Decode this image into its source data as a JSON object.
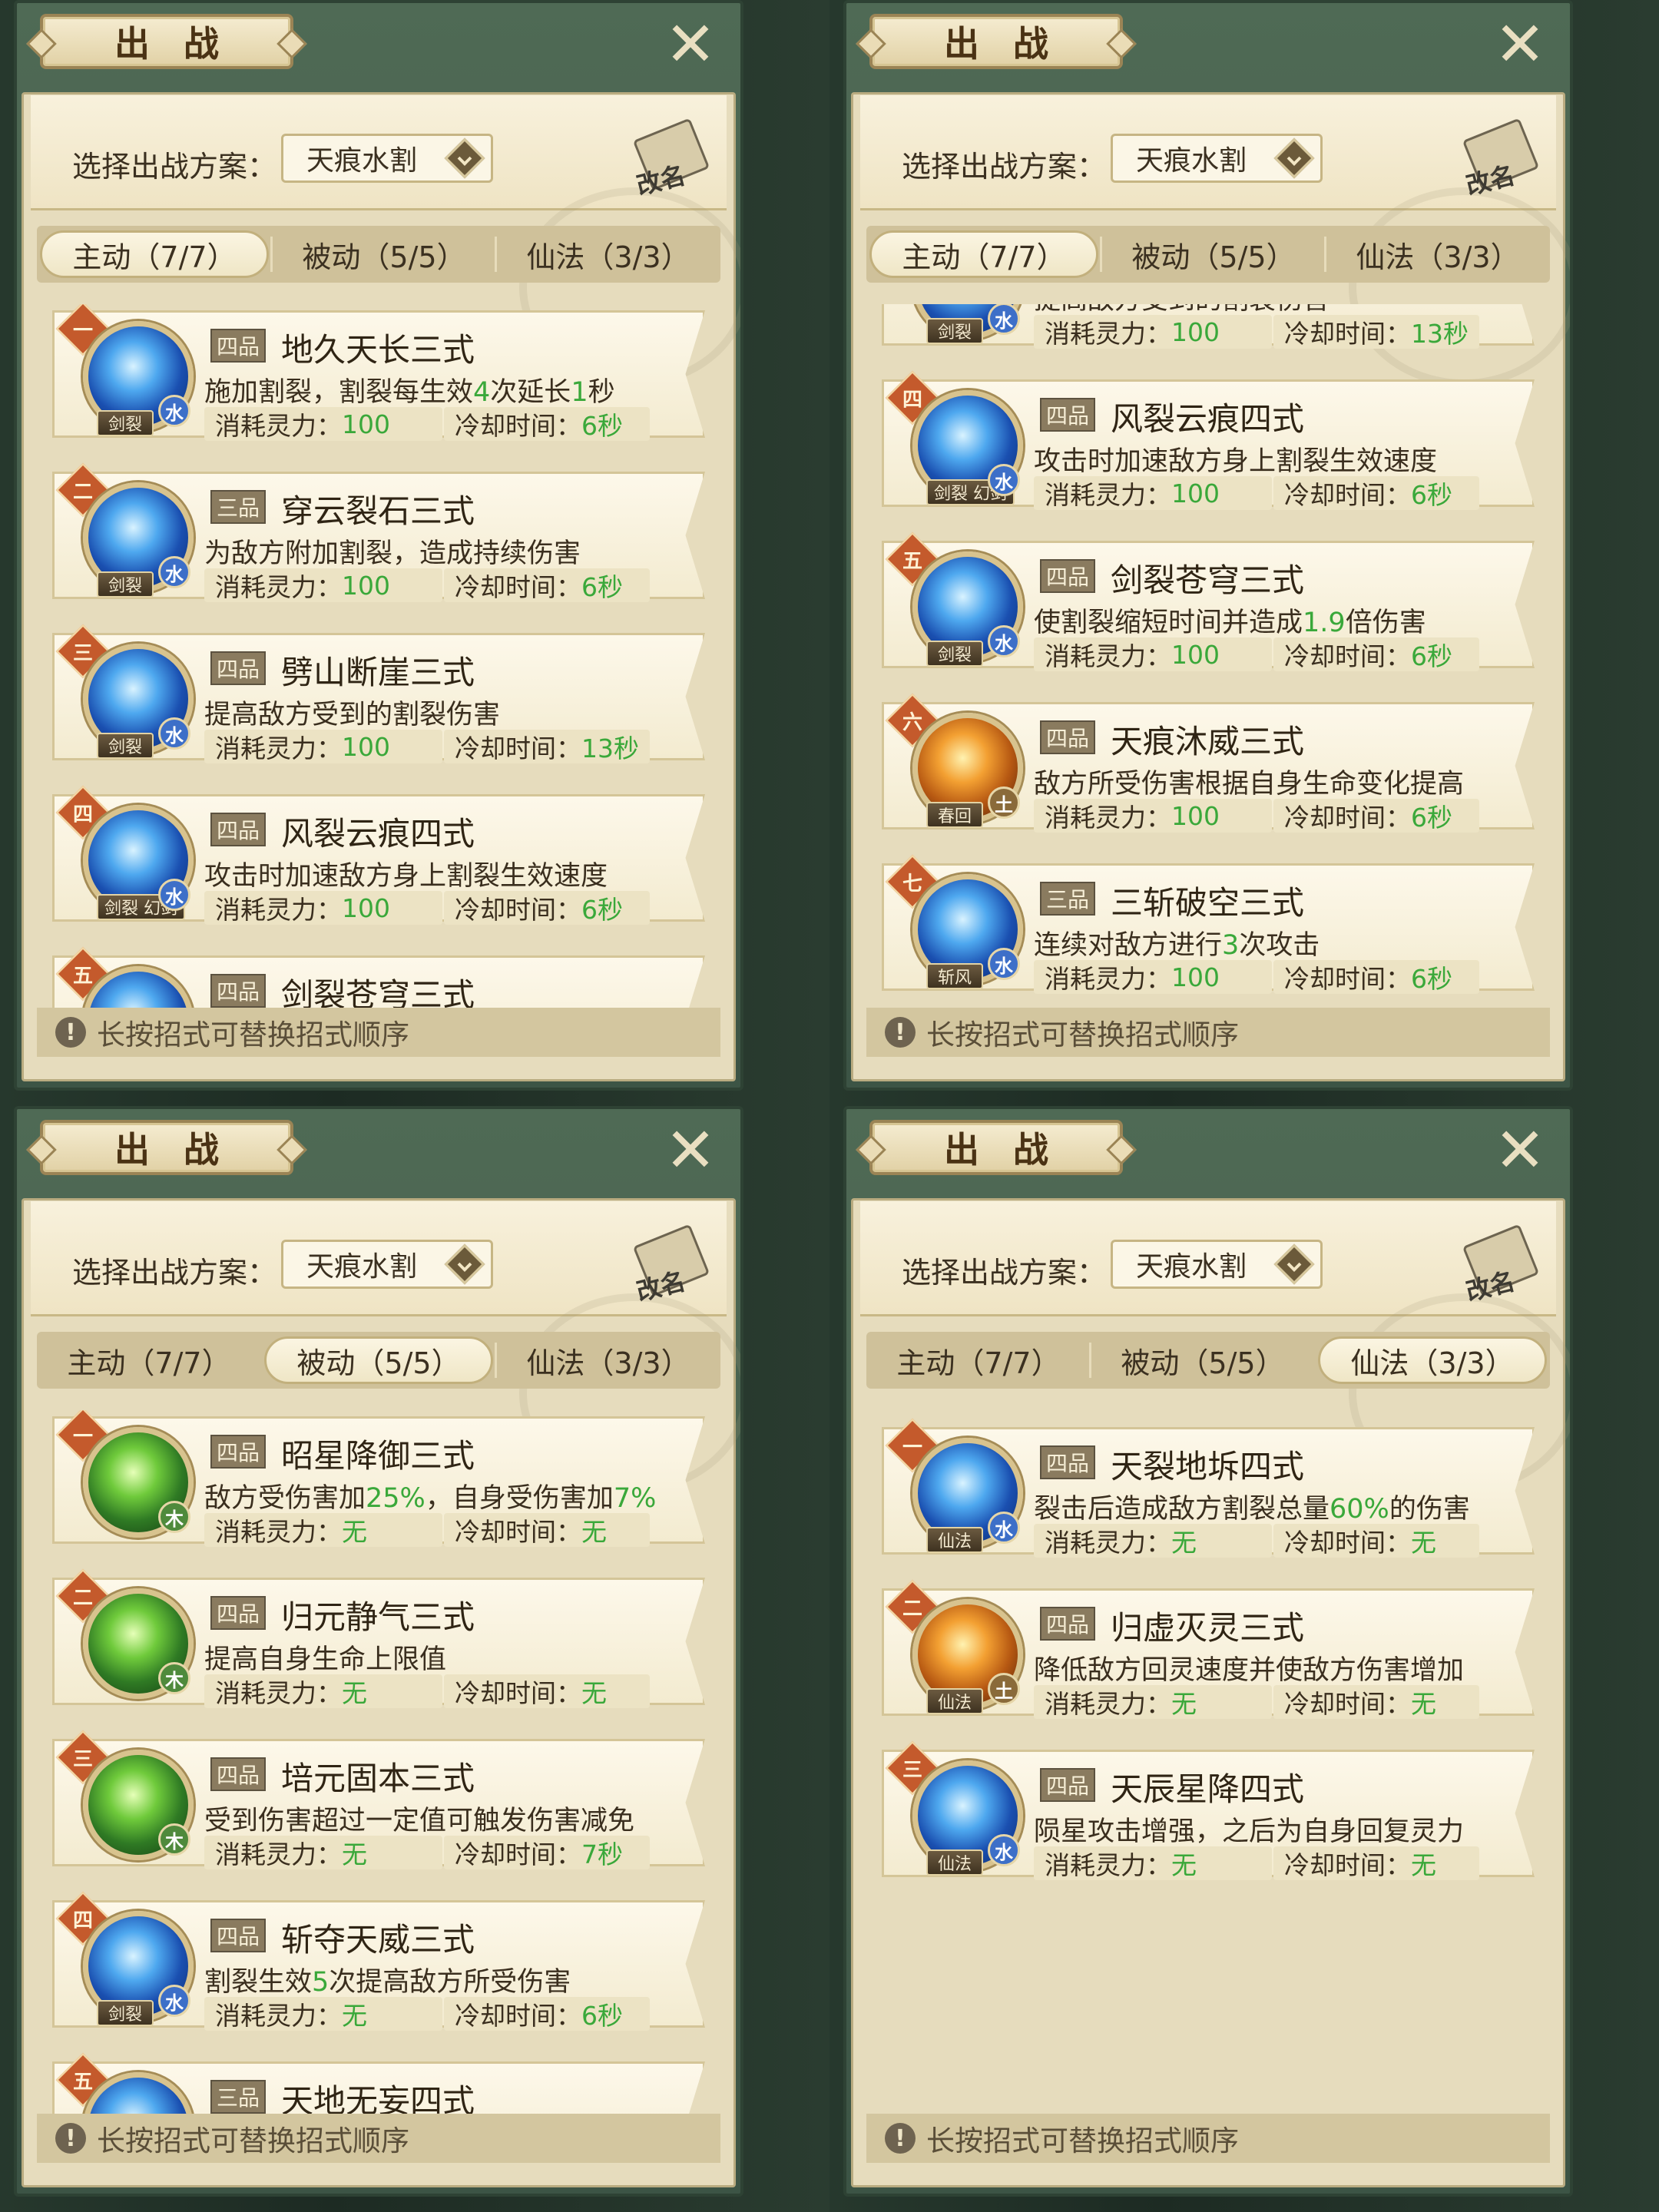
{
  "panel_title": "出战",
  "close_icon": "close-icon",
  "scheme_label": "选择出战方案：",
  "scheme_value": "天痕水割",
  "rename_label": "改名",
  "footer_tip": "长按招式可替换招式顺序",
  "stat_labels": {
    "cost": "消耗灵力：",
    "cd": "冷却时间："
  },
  "tabs": [
    "主动（7/7）",
    "被动（5/5）",
    "仙法（3/3）"
  ],
  "colors": {
    "accent_green": "#3aa83a",
    "rank_badge": "#c45a2c",
    "panel_green": "#4f6a55"
  },
  "panels": [
    {
      "active_tab": 0,
      "cards": [
        {
          "rank": "一",
          "grade": "四品",
          "name": "地久天长三式",
          "desc": [
            [
              "施加割裂，割裂每生效",
              ""
            ],
            [
              "4",
              "hl"
            ],
            [
              "次延长",
              ""
            ],
            [
              "1",
              "hl"
            ],
            [
              "秒",
              ""
            ]
          ],
          "cost": "100",
          "cd": "6秒",
          "tag": "剑裂",
          "elem": "水",
          "orb": "water"
        },
        {
          "rank": "二",
          "grade": "三品",
          "name": "穿云裂石三式",
          "desc": [
            [
              "为敌方附加割裂，造成持续伤害",
              ""
            ]
          ],
          "cost": "100",
          "cd": "6秒",
          "tag": "剑裂",
          "elem": "水",
          "orb": "water"
        },
        {
          "rank": "三",
          "grade": "四品",
          "name": "劈山断崖三式",
          "desc": [
            [
              "提高敌方受到的割裂伤害",
              ""
            ]
          ],
          "cost": "100",
          "cd": "13秒",
          "tag": "剑裂",
          "elem": "水",
          "orb": "water"
        },
        {
          "rank": "四",
          "grade": "四品",
          "name": "风裂云痕四式",
          "desc": [
            [
              "攻击时加速敌方身上割裂生效速度",
              ""
            ]
          ],
          "cost": "100",
          "cd": "6秒",
          "tag": "剑裂 幻剑",
          "elem": "水",
          "orb": "water"
        },
        {
          "rank": "五",
          "grade": "四品",
          "name": "剑裂苍穹三式",
          "desc": [],
          "cost": "",
          "cd": "",
          "tag": "",
          "elem": "",
          "orb": "water",
          "partial": "bottom"
        }
      ]
    },
    {
      "active_tab": 0,
      "cards": [
        {
          "rank": "",
          "grade": "",
          "name": "",
          "desc": [
            [
              "提高敌方受到的割裂伤害",
              ""
            ]
          ],
          "cost": "100",
          "cd": "13秒",
          "tag": "剑裂",
          "elem": "水",
          "orb": "water",
          "partial": "top"
        },
        {
          "rank": "四",
          "grade": "四品",
          "name": "风裂云痕四式",
          "desc": [
            [
              "攻击时加速敌方身上割裂生效速度",
              ""
            ]
          ],
          "cost": "100",
          "cd": "6秒",
          "tag": "剑裂 幻剑",
          "elem": "水",
          "orb": "water"
        },
        {
          "rank": "五",
          "grade": "四品",
          "name": "剑裂苍穹三式",
          "desc": [
            [
              "使割裂缩短时间并造成",
              ""
            ],
            [
              "1.9",
              "hl"
            ],
            [
              "倍伤害",
              ""
            ]
          ],
          "cost": "100",
          "cd": "6秒",
          "tag": "剑裂",
          "elem": "水",
          "orb": "water"
        },
        {
          "rank": "六",
          "grade": "四品",
          "name": "天痕沐威三式",
          "desc": [
            [
              "敌方所受伤害根据自身生命变化提高",
              ""
            ]
          ],
          "cost": "100",
          "cd": "6秒",
          "tag": "春回",
          "elem": "土",
          "orb": "earth"
        },
        {
          "rank": "七",
          "grade": "三品",
          "name": "三斩破空三式",
          "desc": [
            [
              "连续对敌方进行",
              ""
            ],
            [
              "3",
              "hl"
            ],
            [
              "次攻击",
              ""
            ]
          ],
          "cost": "100",
          "cd": "6秒",
          "tag": "斩风",
          "elem": "水",
          "orb": "water"
        }
      ]
    },
    {
      "active_tab": 1,
      "cards": [
        {
          "rank": "一",
          "grade": "四品",
          "name": "昭星降御三式",
          "desc": [
            [
              "敌方受伤害加",
              ""
            ],
            [
              "25%",
              "hl"
            ],
            [
              "，自身受伤害加",
              ""
            ],
            [
              "7%",
              "hl"
            ]
          ],
          "cost": "无",
          "cd": "无",
          "tag": "",
          "elem": "木",
          "orb": "wood"
        },
        {
          "rank": "二",
          "grade": "四品",
          "name": "归元静气三式",
          "desc": [
            [
              "提高自身生命上限值",
              ""
            ]
          ],
          "cost": "无",
          "cd": "无",
          "tag": "",
          "elem": "木",
          "orb": "wood"
        },
        {
          "rank": "三",
          "grade": "四品",
          "name": "培元固本三式",
          "desc": [
            [
              "受到伤害超过一定值可触发伤害减免",
              ""
            ]
          ],
          "cost": "无",
          "cd": "7秒",
          "tag": "",
          "elem": "木",
          "orb": "wood"
        },
        {
          "rank": "四",
          "grade": "四品",
          "name": "斩夺天威三式",
          "desc": [
            [
              "割裂生效",
              ""
            ],
            [
              "5",
              "hl"
            ],
            [
              "次提高敌方所受伤害",
              ""
            ]
          ],
          "cost": "无",
          "cd": "6秒",
          "tag": "剑裂",
          "elem": "水",
          "orb": "water"
        },
        {
          "rank": "五",
          "grade": "三品",
          "name": "天地无妄四式",
          "desc": [],
          "cost": "",
          "cd": "",
          "tag": "",
          "elem": "",
          "orb": "water",
          "partial": "bottom"
        }
      ]
    },
    {
      "active_tab": 2,
      "cards": [
        {
          "rank": "一",
          "grade": "四品",
          "name": "天裂地坼四式",
          "desc": [
            [
              "裂击后造成敌方割裂总量",
              ""
            ],
            [
              "60%",
              "hl"
            ],
            [
              "的伤害",
              ""
            ]
          ],
          "cost": "无",
          "cd": "无",
          "tag": "仙法",
          "elem": "水",
          "orb": "water"
        },
        {
          "rank": "二",
          "grade": "四品",
          "name": "归虚灭灵三式",
          "desc": [
            [
              "降低敌方回灵速度并使敌方伤害增加",
              ""
            ]
          ],
          "cost": "无",
          "cd": "无",
          "tag": "仙法",
          "elem": "土",
          "orb": "earth"
        },
        {
          "rank": "三",
          "grade": "四品",
          "name": "天辰星降四式",
          "desc": [
            [
              "陨星攻击增强，之后为自身回复灵力",
              ""
            ]
          ],
          "cost": "无",
          "cd": "无",
          "tag": "仙法",
          "elem": "水",
          "orb": "water"
        }
      ]
    }
  ]
}
